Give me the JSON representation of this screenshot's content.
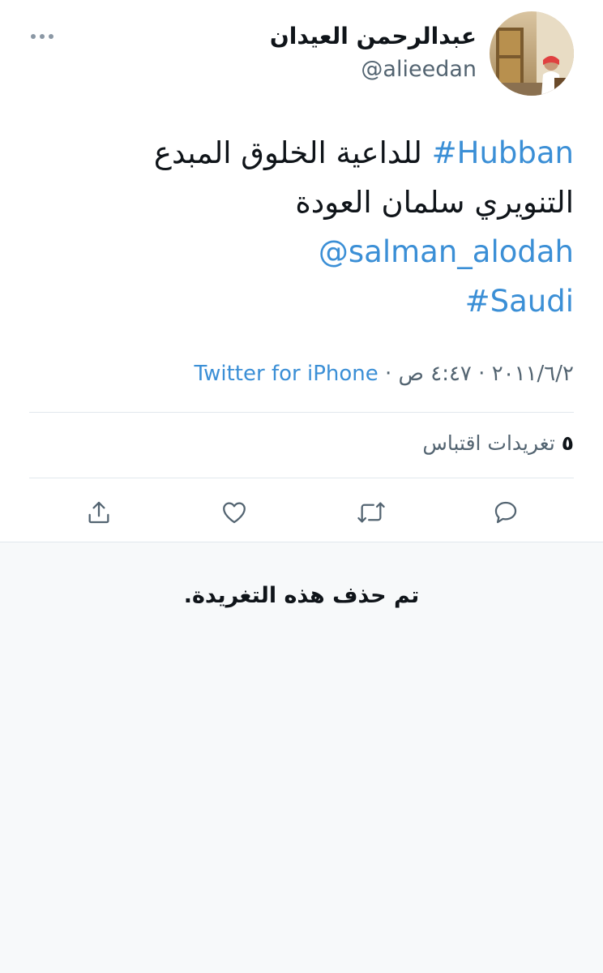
{
  "tweet": {
    "author": {
      "display_name": "عبدالرحمن العيدان",
      "handle": "@alieedan"
    },
    "text": {
      "hashtag_hubban": "#Hubban",
      "line1_rest": " للداعية الخلوق المبدع",
      "line2": "التنويري سلمان العودة",
      "mention": "@salman_alodah",
      "hashtag_saudi": "#Saudi"
    },
    "meta": {
      "date": "٢٠١١/٦/٢",
      "separator1": " · ",
      "time": "٤:٤٧ ص",
      "separator2": " · ",
      "source": "Twitter for iPhone"
    },
    "stats": {
      "quote_count": "٥",
      "quote_label": " تغريدات اقتباس"
    },
    "actions": [
      "reply",
      "retweet",
      "like",
      "share"
    ]
  },
  "deleted_notice": "تم حذف هذه التغريدة.",
  "colors": {
    "link": "#3b8fd6",
    "text": "#0f1419",
    "secondary": "#536471",
    "divider": "#e1e8ed",
    "panel_bg": "#f7f9fa"
  }
}
